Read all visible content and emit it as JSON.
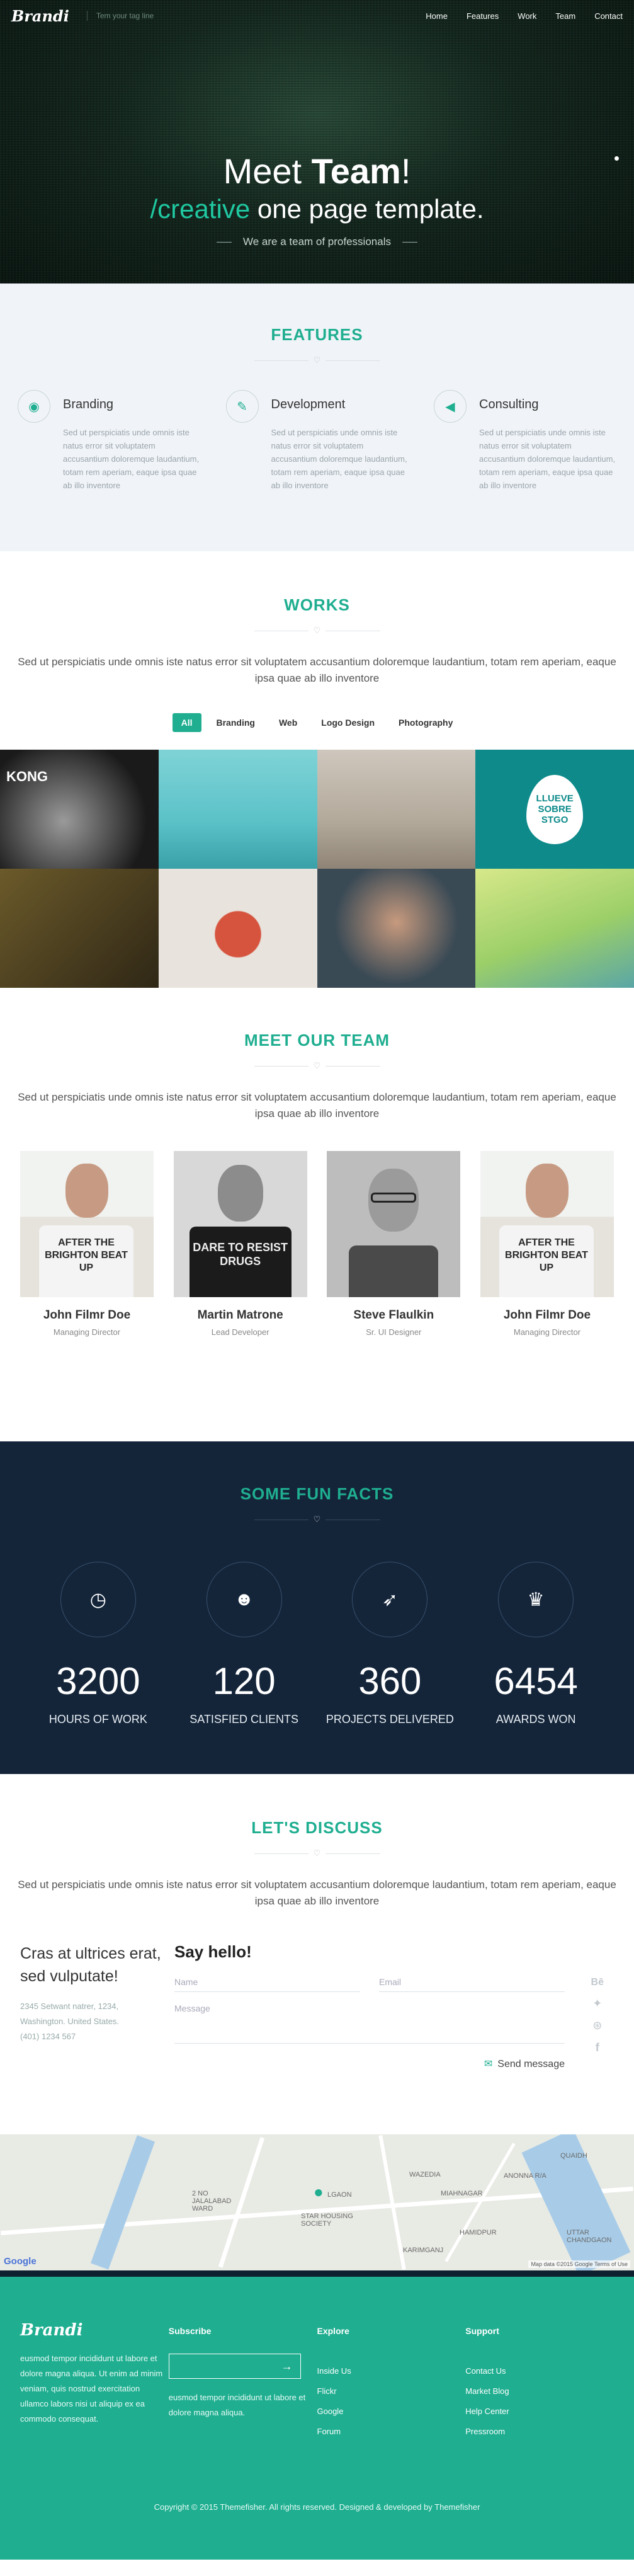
{
  "header": {
    "logo": "Brandi",
    "tagline": "Tem your tag line",
    "nav": [
      "Home",
      "Features",
      "Work",
      "Team",
      "Contact"
    ]
  },
  "hero": {
    "title_pre": "Meet ",
    "title_bold": "Team",
    "title_post": "!",
    "subtitle_accent": "/creative",
    "subtitle_rest": " one page template.",
    "caption": "We are a team of professionals"
  },
  "features": {
    "title": "FEATURES",
    "items": [
      {
        "icon": "github-icon",
        "title": "Branding",
        "text": "Sed ut perspiciatis unde omnis iste natus error sit voluptatem accusantium doloremque laudantium, totam rem aperiam, eaque ipsa quae ab illo inventore"
      },
      {
        "icon": "pencil-icon",
        "title": "Development",
        "text": "Sed ut perspiciatis unde omnis iste natus error sit voluptatem accusantium doloremque laudantium, totam rem aperiam, eaque ipsa quae ab illo inventore"
      },
      {
        "icon": "megaphone-icon",
        "title": "Consulting",
        "text": "Sed ut perspiciatis unde omnis iste natus error sit voluptatem accusantium doloremque laudantium, totam rem aperiam, eaque ipsa quae ab illo inventore"
      }
    ]
  },
  "works": {
    "title": "WORKS",
    "lead": "Sed ut perspiciatis unde omnis iste natus error sit voluptatem accusantium doloremque laudantium, totam rem aperiam, eaque ipsa quae ab illo inventore",
    "filters": [
      "All",
      "Branding",
      "Web",
      "Logo Design",
      "Photography"
    ],
    "active_filter": "All",
    "tile_text": "LLUEVE SOBRE STGO",
    "tile_text_2": "KONG"
  },
  "team": {
    "title": "MEET OUR TEAM",
    "lead": "Sed ut perspiciatis unde omnis iste natus error sit voluptatem accusantium doloremque laudantium, totam rem aperiam, eaque ipsa quae ab illo inventore",
    "members": [
      {
        "name": "John Filmr Doe",
        "role": "Managing Director",
        "shirt": "AFTER THE BRIGHTON BEAT UP"
      },
      {
        "name": "Martin Matrone",
        "role": "Lead Developer",
        "shirt": "DARE TO RESIST DRUGS"
      },
      {
        "name": "Steve Flaulkin",
        "role": "Sr. UI Designer",
        "shirt": ""
      },
      {
        "name": "John Filmr Doe",
        "role": "Managing Director",
        "shirt": "AFTER THE BRIGHTON BEAT UP"
      }
    ]
  },
  "facts": {
    "title": "SOME FUN FACTS",
    "items": [
      {
        "icon": "clock-icon",
        "number": "3200",
        "label": "HOURS OF WORK"
      },
      {
        "icon": "users-icon",
        "number": "120",
        "label": "SATISFIED CLIENTS"
      },
      {
        "icon": "rocket-icon",
        "number": "360",
        "label": "PROJECTS DELIVERED"
      },
      {
        "icon": "trophy-icon",
        "number": "6454",
        "label": "AWARDS WON"
      }
    ]
  },
  "discuss": {
    "title": "LET'S DISCUSS",
    "lead": "Sed ut perspiciatis unde omnis iste natus error sit voluptatem accusantium doloremque laudantium, totam rem aperiam, eaque ipsa quae ab illo inventore",
    "address_heading": "Cras at ultrices erat, sed vulputate!",
    "address_lines": [
      "2345 Setwant natrer, 1234,",
      "Washington. United States.",
      "(401) 1234 567"
    ],
    "form_title": "Say hello!",
    "name_placeholder": "Name",
    "email_placeholder": "Email",
    "message_placeholder": "Message",
    "send_label": "Send message",
    "social": [
      "behance-icon",
      "twitter-icon",
      "dribbble-icon",
      "facebook-icon"
    ]
  },
  "map": {
    "labels": [
      "2 NO JALALABAD WARD",
      "STAR HOUSING SOCIETY",
      "WAZEDIA",
      "ANONNA R/A",
      "MIAHNAGAR",
      "HAMIDPUR",
      "KARIMGANJ",
      "UTTAR CHANDGAON",
      "QUAIDH",
      "LGAON"
    ],
    "google": "Google",
    "credit": "Map data ©2015 Google   Terms of Use"
  },
  "footer": {
    "logo": "Brandi",
    "about": "eusmod tempor incididunt ut labore et dolore magna aliqua. Ut enim ad minim veniam, quis nostrud exercitation ullamco labors nisi ut aliquip ex ea commodo consequat.",
    "subscribe_title": "Subscribe",
    "subscribe_text": "eusmod tempor incididunt ut labore et dolore magna aliqua.",
    "explore_title": "Explore",
    "explore": [
      "Inside Us",
      "Flickr",
      "Google",
      "Forum"
    ],
    "support_title": "Support",
    "support": [
      "Contact Us",
      "Market Blog",
      "Help Center",
      "Pressroom"
    ],
    "copyright": "Copyright © 2015 Themefisher. All rights reserved. Designed & developed by Themefisher"
  },
  "colors": {
    "accent": "#1fae90",
    "dark": "#14253a",
    "hero": "#15271f"
  }
}
